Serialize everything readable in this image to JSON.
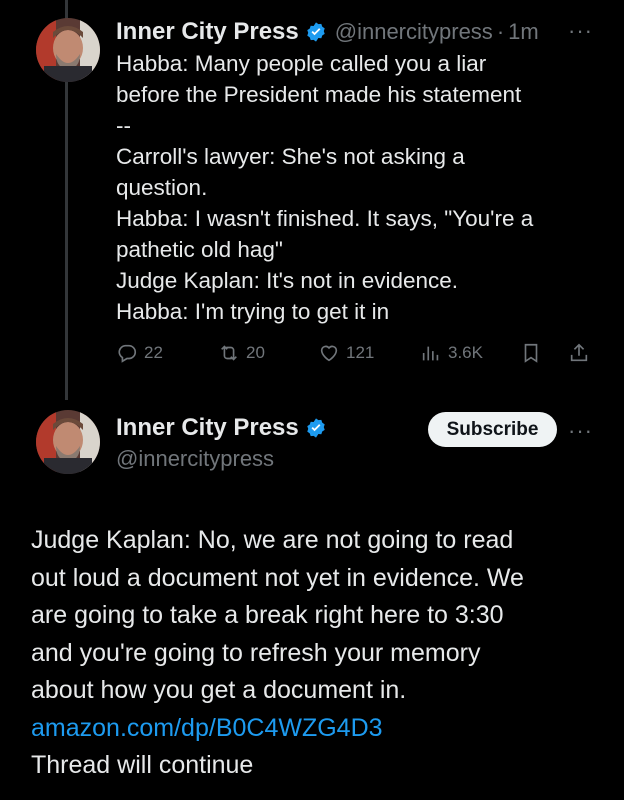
{
  "tweet1": {
    "author_name": "Inner City Press",
    "handle": "@innercitypress",
    "separator": "·",
    "time": "1m",
    "more_label": "···",
    "text_lines": [
      "Habba: Many people called you a liar",
      "before the President made his statement",
      "--",
      "Carroll's lawyer: She's not asking a",
      "question.",
      "Habba: I wasn't finished. It says, \"You're a",
      "pathetic old hag\"",
      "Judge Kaplan: It's not in evidence.",
      "Habba: I'm trying to get it in"
    ],
    "stats": {
      "replies": "22",
      "reposts": "20",
      "likes": "121",
      "views": "3.6K"
    }
  },
  "tweet2": {
    "author_name": "Inner City Press",
    "handle": "@innercitypress",
    "subscribe_label": "Subscribe",
    "more_label": "···",
    "text_lines": [
      "Judge Kaplan: No, we are not going to read",
      "out loud a document not yet in evidence. We",
      "are going to take a break right here to 3:30",
      "and you're going to refresh your memory",
      "about how you get a document in."
    ],
    "link": "amazon.com/dp/B0C4WZG4D3",
    "footer": "Thread will continue"
  },
  "colors": {
    "background": "#000000",
    "text": "#e7e9ea",
    "muted": "#71767b",
    "link": "#1d9bf0",
    "verified": "#1d9bf0"
  },
  "icons": [
    "verified-badge-icon",
    "reply-icon",
    "repost-icon",
    "like-icon",
    "views-icon",
    "bookmark-icon",
    "share-icon",
    "more-icon"
  ]
}
